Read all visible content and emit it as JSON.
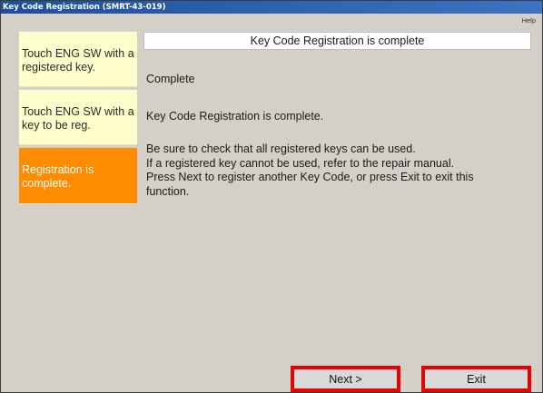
{
  "window": {
    "title": "Key Code Registration (SMRT-43-019)"
  },
  "toolbar": {
    "help_label": "Help"
  },
  "steps": [
    {
      "label": "Touch ENG SW with a registered key.",
      "state": "done"
    },
    {
      "label": "Touch ENG SW with a key to be reg.",
      "state": "done"
    },
    {
      "label": "Registration is complete.",
      "state": "active"
    }
  ],
  "main": {
    "header": "Key Code Registration is complete",
    "status": "Complete",
    "message": "Key Code Registration is complete.",
    "instructions": [
      "Be sure to check that all registered keys can be used.",
      "If a registered key cannot be used, refer to the repair manual.",
      "Press Next to register another Key Code, or press Exit to exit this",
      "function."
    ]
  },
  "buttons": {
    "next_label": "Next >",
    "exit_label": "Exit"
  },
  "colors": {
    "step_pending_bg": "#ffffcc",
    "step_active_bg": "#ff8c00",
    "title_bar": "#2f63b4",
    "highlight_border": "#ee0000"
  }
}
